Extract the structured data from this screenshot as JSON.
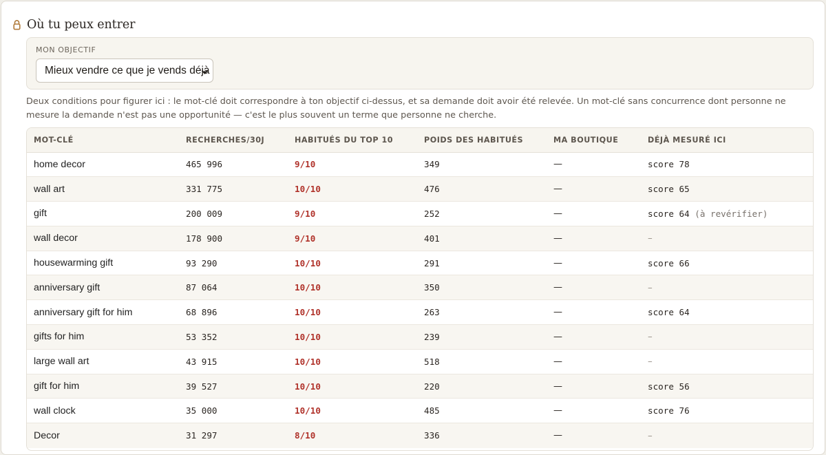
{
  "section": {
    "title": "Où tu peux entrer",
    "icon": "lock-icon"
  },
  "objective": {
    "label": "MON OBJECTIF",
    "selected": "Mieux vendre ce que je vends déjà"
  },
  "hint": "Deux conditions pour figurer ici : le mot-clé doit correspondre à ton objectif ci-dessus, et sa demande doit avoir été relevée. Un mot-clé sans concurrence dont personne ne mesure la demande n'est pas une opportunité — c'est le plus souvent un terme que personne ne cherche.",
  "table": {
    "headers": [
      "MOT-CLÉ",
      "RECHERCHES/30J",
      "HABITUÉS DU TOP 10",
      "POIDS DES HABITUÉS",
      "MA BOUTIQUE",
      "DÉJÀ MESURÉ ICI"
    ],
    "rows": [
      {
        "keyword": "home decor",
        "searches": "465 996",
        "top10": "9/10",
        "weight": "349",
        "shop": "—",
        "measured": "score 78",
        "note": ""
      },
      {
        "keyword": "wall art",
        "searches": "331 775",
        "top10": "10/10",
        "weight": "476",
        "shop": "—",
        "measured": "score 65",
        "note": ""
      },
      {
        "keyword": "gift",
        "searches": "200 009",
        "top10": "9/10",
        "weight": "252",
        "shop": "—",
        "measured": "score 64",
        "note": "(à revérifier)"
      },
      {
        "keyword": "wall decor",
        "searches": "178 900",
        "top10": "9/10",
        "weight": "401",
        "shop": "—",
        "measured": "–",
        "note": ""
      },
      {
        "keyword": "housewarming gift",
        "searches": "93 290",
        "top10": "10/10",
        "weight": "291",
        "shop": "—",
        "measured": "score 66",
        "note": ""
      },
      {
        "keyword": "anniversary gift",
        "searches": "87 064",
        "top10": "10/10",
        "weight": "350",
        "shop": "—",
        "measured": "–",
        "note": ""
      },
      {
        "keyword": "anniversary gift for him",
        "searches": "68 896",
        "top10": "10/10",
        "weight": "263",
        "shop": "—",
        "measured": "score 64",
        "note": ""
      },
      {
        "keyword": "gifts for him",
        "searches": "53 352",
        "top10": "10/10",
        "weight": "239",
        "shop": "—",
        "measured": "–",
        "note": ""
      },
      {
        "keyword": "large wall art",
        "searches": "43 915",
        "top10": "10/10",
        "weight": "518",
        "shop": "—",
        "measured": "–",
        "note": ""
      },
      {
        "keyword": "gift for him",
        "searches": "39 527",
        "top10": "10/10",
        "weight": "220",
        "shop": "—",
        "measured": "score 56",
        "note": ""
      },
      {
        "keyword": "wall clock",
        "searches": "35 000",
        "top10": "10/10",
        "weight": "485",
        "shop": "—",
        "measured": "score 76",
        "note": ""
      },
      {
        "keyword": "Decor",
        "searches": "31 297",
        "top10": "8/10",
        "weight": "336",
        "shop": "—",
        "measured": "–",
        "note": ""
      }
    ]
  },
  "colors": {
    "accent_red": "#b0322a",
    "lock": "#b07a3a",
    "panel_bg": "#f7f5ef"
  }
}
